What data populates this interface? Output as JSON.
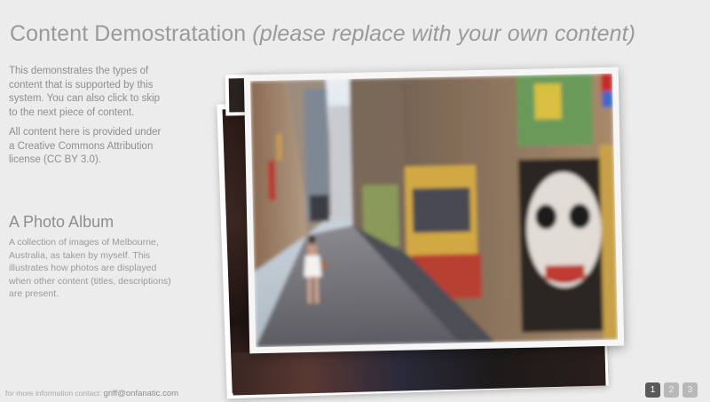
{
  "header": {
    "title": "Content Demostratation",
    "subtitle": "(please replace with your own content)"
  },
  "intro": {
    "paragraph_1": "This demonstrates the types of content that is supported by this system. You can also click to skip to the next piece of content.",
    "paragraph_2": "All content here is provided under a Creative Commons Attribution license (CC BY 3.0)."
  },
  "album": {
    "title": "A Photo Album",
    "description": "A collection of images of Melbourne, Australia, as taken by myself. This illustrates how photos are displayed when other content (titles, descriptions) are present."
  },
  "footer": {
    "label": "for more information contact:",
    "email": "griff@onfanatic.com"
  },
  "pager": {
    "pages": [
      "1",
      "2",
      "3"
    ],
    "current": 1
  },
  "colors": {
    "background": "#ececec",
    "text": "#8e8e8e",
    "pager_active": "#5a5a5a",
    "pager_inactive": "#b8b8b8"
  }
}
